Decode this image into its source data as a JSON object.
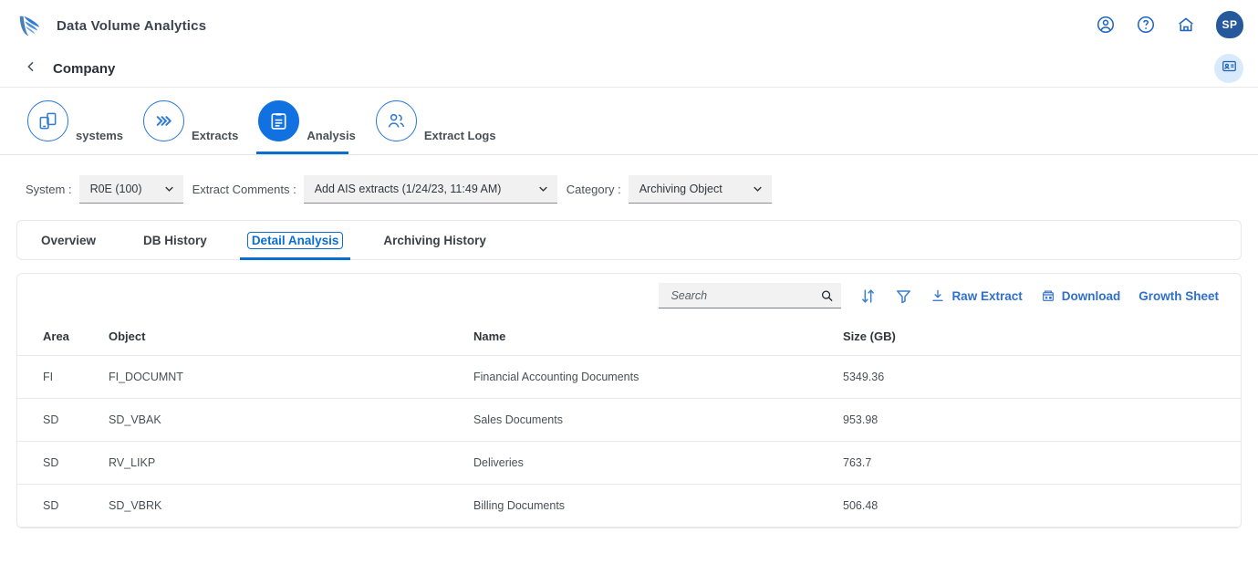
{
  "app": {
    "title": "Data Volume Analytics",
    "logo_icon": "wing-logo"
  },
  "top_actions": {
    "user_icon": "user-circle-icon",
    "help_icon": "help-circle-icon",
    "home_icon": "home-icon",
    "avatar_initials": "SP"
  },
  "breadcrumb": {
    "back_icon": "chevron-left-icon",
    "title": "Company",
    "idcard_icon": "id-card-icon"
  },
  "nav": {
    "items": [
      {
        "label": "systems",
        "icon": "devices-icon",
        "active": false
      },
      {
        "label": "Extracts",
        "icon": "chevrons-right-icon",
        "active": false
      },
      {
        "label": "Analysis",
        "icon": "clipboard-icon",
        "active": true
      },
      {
        "label": "Extract Logs",
        "icon": "users-icon",
        "active": false
      }
    ]
  },
  "filters": [
    {
      "label": "System :",
      "value": "R0E (100)"
    },
    {
      "label": "Extract Comments :",
      "value": "Add AIS extracts (1/24/23, 11:49 AM)"
    },
    {
      "label": "Category :",
      "value": "Archiving Object"
    }
  ],
  "tabs": [
    {
      "label": "Overview",
      "active": false
    },
    {
      "label": "DB History",
      "active": false
    },
    {
      "label": "Detail Analysis",
      "active": true
    },
    {
      "label": "Archiving History",
      "active": false
    }
  ],
  "toolbar": {
    "search_placeholder": "Search",
    "search_value": "",
    "search_icon": "magnifier-icon",
    "sort_icon": "sort-icon",
    "filter_icon": "funnel-icon",
    "raw_extract_label": "Raw Extract",
    "raw_extract_icon": "download-arrow-icon",
    "download_label": "Download",
    "download_icon": "excel-file-icon",
    "growth_sheet_label": "Growth Sheet"
  },
  "table": {
    "columns": [
      "Area",
      "Object",
      "Name",
      "Size (GB)"
    ],
    "rows": [
      {
        "area": "FI",
        "object": "FI_DOCUMNT",
        "name": "Financial Accounting Documents",
        "size": "5349.36"
      },
      {
        "area": "SD",
        "object": "SD_VBAK",
        "name": "Sales Documents",
        "size": "953.98"
      },
      {
        "area": "SD",
        "object": "RV_LIKP",
        "name": "Deliveries",
        "size": "763.7"
      },
      {
        "area": "SD",
        "object": "SD_VBRK",
        "name": "Billing Documents",
        "size": "506.48"
      }
    ]
  },
  "colors": {
    "accent": "#0a6ed1",
    "link": "#2f6fd0",
    "avatar_bg": "#25599c",
    "idcard_bg": "#d9eafc"
  }
}
